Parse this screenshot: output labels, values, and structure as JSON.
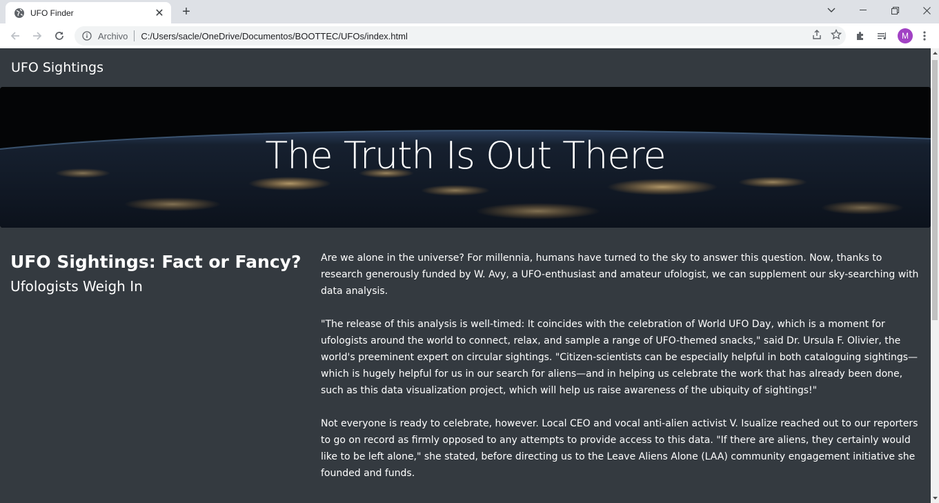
{
  "browser": {
    "tab": {
      "title": "UFO Finder",
      "close_glyph": "✕",
      "favicon": "globe-icon"
    },
    "new_tab_glyph": "+",
    "address": {
      "security_chip": "Archivo",
      "url": "C:/Users/sacle/OneDrive/Documentos/BOOTTEC/UFOs/index.html"
    },
    "profile_initial": "M",
    "colors": {
      "tabstrip": "#dee1e6",
      "omnibox": "#f1f3f4",
      "avatar": "#a142c4"
    }
  },
  "page": {
    "navbar": {
      "brand": "UFO Sightings"
    },
    "hero": {
      "title": "The Truth Is Out There"
    },
    "article": {
      "headline": "UFO Sightings: Fact or Fancy?",
      "subheadline": "Ufologists Weigh In",
      "paragraphs": [
        "Are we alone in the universe? For millennia, humans have turned to the sky to answer this question. Now, thanks to research generously funded by W. Avy, a UFO-enthusiast and amateur ufologist, we can supplement our sky-searching with data analysis.",
        "\"The release of this analysis is well-timed: It coincides with the celebration of World UFO Day, which is a moment for ufologists around the world to connect, relax, and sample a range of UFO-themed snacks,\" said Dr. Ursula F. Olivier, the world's preeminent expert on circular sightings. \"Citizen-scientists can be especially helpful in both cataloguing sightings—which is hugely helpful for us in our search for aliens—and in helping us celebrate the work that has already been done, such as this data visualization project, which will help us raise awareness of the ubiquity of sightings!\"",
        "Not everyone is ready to celebrate, however. Local CEO and vocal anti-alien activist V. Isualize reached out to our reporters to go on record as firmly opposed to any attempts to provide access to this data. \"If there are aliens, they certainly would like to be left alone,\" she stated, before directing us to the Leave Aliens Alone (LAA) community engagement initiative she founded and funds."
      ]
    },
    "colors": {
      "background": "#343a40",
      "text": "#ffffff"
    }
  }
}
